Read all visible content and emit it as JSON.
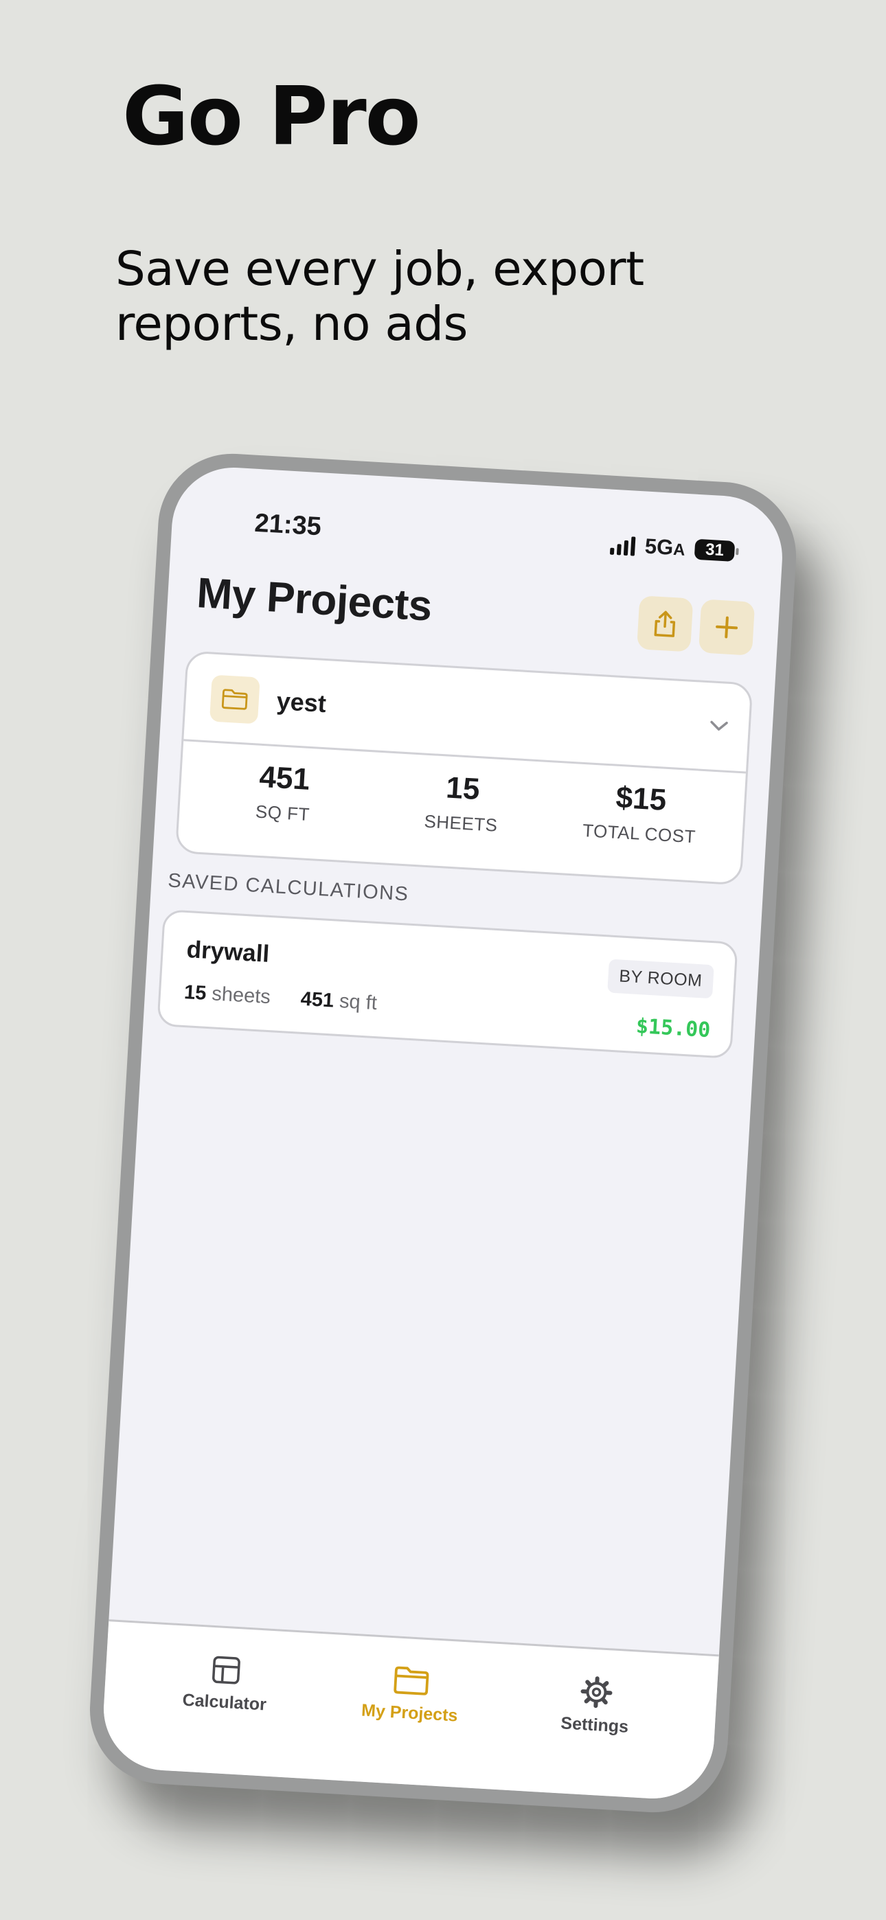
{
  "promo": {
    "headline": "Go Pro",
    "subhead": "Save every job, export reports, no ads"
  },
  "status_bar": {
    "time": "21:35",
    "network": "5G",
    "network_suffix": "A",
    "battery": "31"
  },
  "header": {
    "title": "My Projects",
    "share_icon": "share-icon",
    "add_icon": "plus-icon"
  },
  "project": {
    "name": "yest",
    "stats": [
      {
        "value": "451",
        "label": "SQ FT"
      },
      {
        "value": "15",
        "label": "SHEETS"
      },
      {
        "value": "$15",
        "label": "TOTAL COST"
      }
    ]
  },
  "saved": {
    "section_label": "SAVED CALCULATIONS",
    "items": [
      {
        "name": "drywall",
        "sheets_value": "15",
        "sheets_unit": "sheets",
        "area_value": "451",
        "area_unit": "sq ft",
        "mode": "BY ROOM",
        "price": "$15.00"
      }
    ]
  },
  "tabs": [
    {
      "label": "Calculator",
      "icon": "calculator-icon",
      "active": false
    },
    {
      "label": "My Projects",
      "icon": "folder-icon",
      "active": true
    },
    {
      "label": "Settings",
      "icon": "gear-icon",
      "active": false
    }
  ],
  "colors": {
    "background": "#e2e3df",
    "accent": "#d4a017",
    "price_green": "#34c759",
    "screen_bg": "#f2f2f7"
  }
}
